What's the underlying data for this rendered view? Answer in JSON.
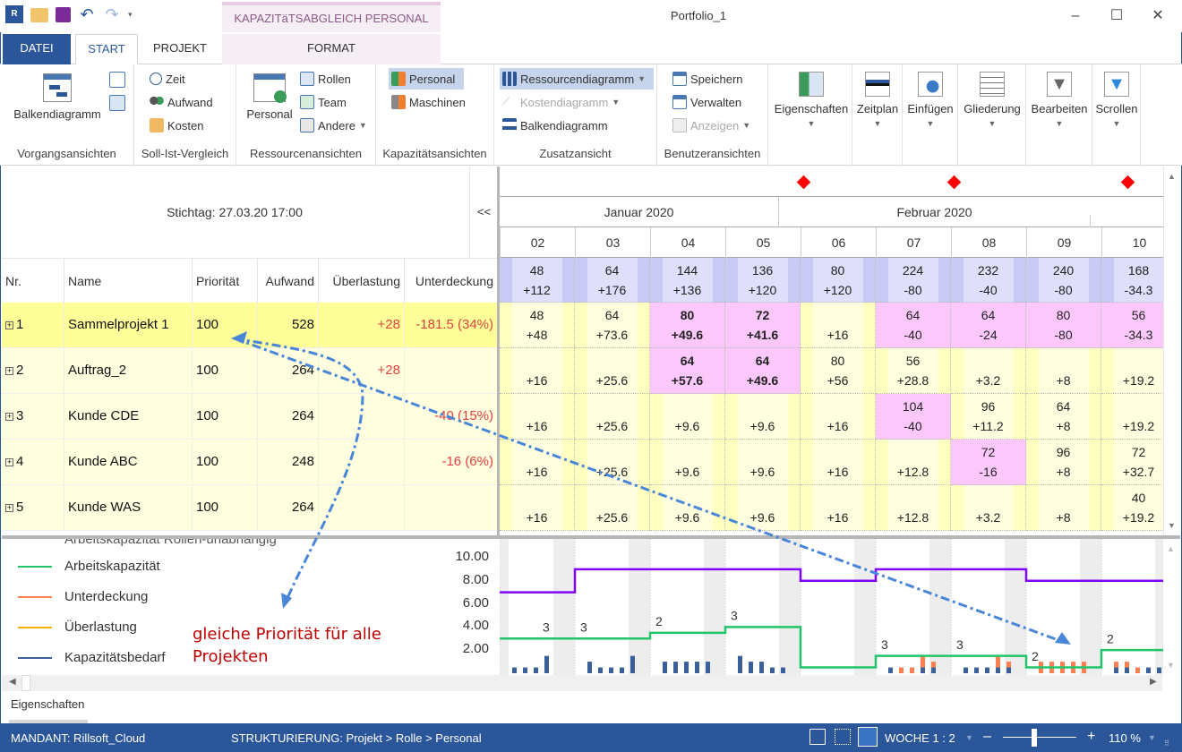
{
  "window": {
    "title": "Portfolio_1",
    "context_tab_group": "KAPAZITäTSABGLEICH PERSONAL",
    "controls": {
      "minimize": "–",
      "maximize": "☐",
      "close": "✕"
    }
  },
  "tabs": [
    {
      "label": "DATEI"
    },
    {
      "label": "START",
      "active": true
    },
    {
      "label": "PROJEKT"
    },
    {
      "label": "FORMAT"
    }
  ],
  "ribbon": {
    "groups": {
      "vorgang": {
        "label": "Vorgangsansichten",
        "balken": "Balkendiagramm"
      },
      "sollist": {
        "label": "Soll-Ist-Vergleich",
        "zeit": "Zeit",
        "aufwand": "Aufwand",
        "kosten": "Kosten"
      },
      "ressourcen": {
        "label": "Ressourcenansichten",
        "personal": "Personal",
        "rollen": "Rollen",
        "team": "Team",
        "andere": "Andere"
      },
      "kapazitaet": {
        "label": "Kapazitätsansichten",
        "personal": "Personal",
        "maschinen": "Maschinen"
      },
      "zusatz": {
        "label": "Zusatzansicht",
        "ressourcendiagramm": "Ressourcendiagramm",
        "kostendiagramm": "Kostendiagramm",
        "balkendiagramm": "Balkendiagramm"
      },
      "benutzer": {
        "label": "Benutzeransichten",
        "speichern": "Speichern",
        "verwalten": "Verwalten",
        "anzeigen": "Anzeigen"
      },
      "big": [
        {
          "label": "Eigenschaften"
        },
        {
          "label": "Zeitplan"
        },
        {
          "label": "Einfügen"
        },
        {
          "label": "Gliederung"
        },
        {
          "label": "Bearbeiten"
        },
        {
          "label": "Scrollen"
        }
      ]
    }
  },
  "left": {
    "stichtag": "Stichtag: 27.03.20 17:00",
    "collapse": "<<",
    "columns": [
      "Nr.",
      "Name",
      "Priorität",
      "Aufwand",
      "Überlastung",
      "Unterdeckung"
    ],
    "rows": [
      {
        "nr": "1",
        "name": "Sammelprojekt 1",
        "prio": "100",
        "aufwand": "528",
        "ueberlastung": "+28",
        "unterdeckung": "-181.5 (34%)"
      },
      {
        "nr": "2",
        "name": "Auftrag_2",
        "prio": "100",
        "aufwand": "264",
        "ueberlastung": "+28",
        "unterdeckung": ""
      },
      {
        "nr": "3",
        "name": "Kunde CDE",
        "prio": "100",
        "aufwand": "264",
        "ueberlastung": "",
        "unterdeckung": "-40 (15%)"
      },
      {
        "nr": "4",
        "name": "Kunde ABC",
        "prio": "100",
        "aufwand": "248",
        "ueberlastung": "",
        "unterdeckung": "-16 (6%)"
      },
      {
        "nr": "5",
        "name": "Kunde WAS",
        "prio": "100",
        "aufwand": "264",
        "ueberlastung": "",
        "unterdeckung": ""
      }
    ]
  },
  "timeline": {
    "months": [
      "Januar 2020",
      "Februar 2020"
    ],
    "weeks": [
      "02",
      "03",
      "04",
      "05",
      "06",
      "07",
      "08",
      "09",
      "10"
    ],
    "summary": [
      [
        "48",
        "+112"
      ],
      [
        "64",
        "+176"
      ],
      [
        "144",
        "+136"
      ],
      [
        "136",
        "+120"
      ],
      [
        "80",
        "+120"
      ],
      [
        "224",
        "-80"
      ],
      [
        "232",
        "-40"
      ],
      [
        "240",
        "-80"
      ],
      [
        "168",
        "-34.3"
      ]
    ],
    "cells": [
      [
        [
          "48",
          "+48",
          ""
        ],
        [
          "64",
          "+73.6",
          ""
        ],
        [
          "80",
          "+49.6",
          "pb"
        ],
        [
          "72",
          "+41.6",
          "pb"
        ],
        [
          "",
          "+16",
          ""
        ],
        [
          "64",
          "-40",
          "p"
        ],
        [
          "64",
          "-24",
          "p"
        ],
        [
          "80",
          "-80",
          "p"
        ],
        [
          "56",
          "-34.3",
          "p"
        ]
      ],
      [
        [
          "",
          "+16",
          ""
        ],
        [
          "",
          "+25.6",
          ""
        ],
        [
          "64",
          "+57.6",
          "pb"
        ],
        [
          "64",
          "+49.6",
          "pb"
        ],
        [
          "80",
          "+56",
          ""
        ],
        [
          "56",
          "+28.8",
          ""
        ],
        [
          "",
          "+3.2",
          ""
        ],
        [
          "",
          "+8",
          ""
        ],
        [
          "",
          "+19.2",
          ""
        ]
      ],
      [
        [
          "",
          "+16",
          ""
        ],
        [
          "",
          "+25.6",
          ""
        ],
        [
          "",
          "+9.6",
          ""
        ],
        [
          "",
          "+9.6",
          ""
        ],
        [
          "",
          "+16",
          ""
        ],
        [
          "104",
          "-40",
          "p"
        ],
        [
          "96",
          "+11.2",
          ""
        ],
        [
          "64",
          "+8",
          ""
        ],
        [
          "",
          "+19.2",
          ""
        ]
      ],
      [
        [
          "",
          "+16",
          ""
        ],
        [
          "",
          "+25.6",
          ""
        ],
        [
          "",
          "+9.6",
          ""
        ],
        [
          "",
          "+9.6",
          ""
        ],
        [
          "",
          "+16",
          ""
        ],
        [
          "",
          "+12.8",
          ""
        ],
        [
          "72",
          "-16",
          "p"
        ],
        [
          "96",
          "+8",
          ""
        ],
        [
          "72",
          "+32.7",
          ""
        ]
      ],
      [
        [
          "",
          "+16",
          ""
        ],
        [
          "",
          "+25.6",
          ""
        ],
        [
          "",
          "+9.6",
          ""
        ],
        [
          "",
          "+9.6",
          ""
        ],
        [
          "",
          "+16",
          ""
        ],
        [
          "",
          "+12.8",
          ""
        ],
        [
          "",
          "+3.2",
          ""
        ],
        [
          "",
          "+8",
          ""
        ],
        [
          "40",
          "+19.2",
          ""
        ]
      ]
    ]
  },
  "legend": {
    "cut_item": "Arbeitskapazität Rollen-unabhängig",
    "items": [
      {
        "label": "Arbeitskapazität",
        "color": "#22c46a"
      },
      {
        "label": "Unterdeckung",
        "color": "#ff7f50"
      },
      {
        "label": "Überlastung",
        "color": "#f0b400"
      },
      {
        "label": "Kapazitätsbedarf",
        "color": "#3a5f9a"
      }
    ]
  },
  "annotation": {
    "line1": "gleiche Priorität für alle",
    "line2": "Projekten"
  },
  "chart_data": {
    "type": "bar",
    "ylim": [
      0,
      11
    ],
    "yticks": [
      "10.00",
      "8.00",
      "6.00",
      "4.00",
      "2.00"
    ],
    "categories": [
      "02",
      "03",
      "04",
      "05",
      "06",
      "07",
      "08",
      "09",
      "10"
    ],
    "capacity_independent": [
      7,
      9,
      9,
      9,
      8,
      9,
      9,
      8,
      8
    ],
    "capacity": [
      3,
      3,
      3.5,
      4,
      0.5,
      1.5,
      1.5,
      0.5,
      2
    ],
    "week_labels": [
      "3",
      "3",
      "2",
      "3",
      "",
      "3",
      "3",
      "2",
      "2"
    ],
    "daily_demand": [
      [
        1,
        1,
        1,
        3
      ],
      [
        2,
        1,
        1,
        1,
        3
      ],
      [
        2,
        2,
        2,
        2,
        2
      ],
      [
        3,
        2,
        2,
        1,
        1
      ],
      [],
      [
        1,
        1,
        1,
        3,
        2
      ],
      [
        1,
        1,
        1,
        3,
        2
      ],
      [
        2,
        2,
        2,
        2,
        2
      ],
      [
        2,
        2,
        1,
        1,
        1
      ]
    ],
    "daily_shortfall": [
      [
        0,
        0,
        0,
        0
      ],
      [
        0,
        0,
        0,
        0,
        0
      ],
      [
        0,
        0,
        0,
        0,
        0
      ],
      [
        0,
        0,
        0,
        0,
        0
      ],
      [],
      [
        0,
        1,
        1,
        2,
        1
      ],
      [
        0,
        0,
        0,
        2,
        1
      ],
      [
        2,
        2,
        2,
        2,
        2
      ],
      [
        1,
        1,
        1,
        0,
        0
      ]
    ]
  },
  "properties_panel": {
    "label": "Eigenschaften"
  },
  "status": {
    "mandant": "MANDANT: Rillsoft_Cloud",
    "struktur": "STRUKTURIERUNG: Projekt > Rolle > Personal",
    "scale": "WOCHE 1 : 2",
    "zoom_minus": "–",
    "zoom_plus": "+",
    "zoom": "110 %"
  }
}
